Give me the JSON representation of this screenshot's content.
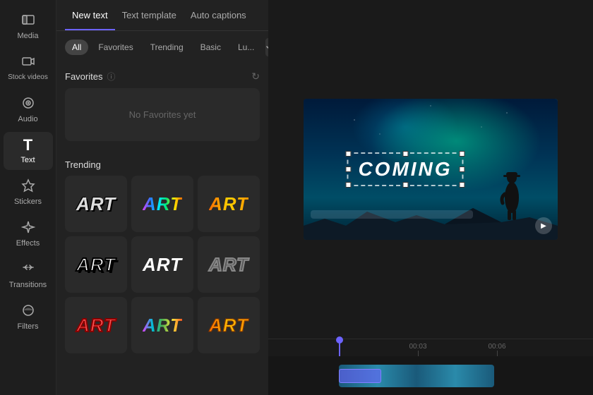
{
  "sidebar": {
    "items": [
      {
        "id": "media",
        "label": "Media",
        "icon": "▦"
      },
      {
        "id": "stock-videos",
        "label": "Stock videos",
        "icon": "⊞"
      },
      {
        "id": "audio",
        "label": "Audio",
        "icon": "◎"
      },
      {
        "id": "text",
        "label": "Text",
        "icon": "T"
      },
      {
        "id": "stickers",
        "label": "Stickers",
        "icon": "✦"
      },
      {
        "id": "effects",
        "label": "Effects",
        "icon": "✦"
      },
      {
        "id": "transitions",
        "label": "Transitions",
        "icon": "⇄"
      },
      {
        "id": "filters",
        "label": "Filters",
        "icon": "◑"
      }
    ]
  },
  "panel": {
    "tabs": [
      {
        "id": "new-text",
        "label": "New text"
      },
      {
        "id": "text-template",
        "label": "Text template"
      },
      {
        "id": "auto-captions",
        "label": "Auto captions"
      }
    ],
    "active_tab": "new-text",
    "filters": [
      {
        "id": "all",
        "label": "All"
      },
      {
        "id": "favorites",
        "label": "Favorites"
      },
      {
        "id": "trending",
        "label": "Trending"
      },
      {
        "id": "basic",
        "label": "Basic"
      },
      {
        "id": "lu",
        "label": "Lu..."
      }
    ],
    "favorites_section": {
      "title": "Favorites",
      "empty_message": "No Favorites yet"
    },
    "trending_section": {
      "title": "Trending",
      "items": [
        {
          "id": "art-1",
          "style": "plain"
        },
        {
          "id": "art-2",
          "style": "rainbow"
        },
        {
          "id": "art-3",
          "style": "gold"
        },
        {
          "id": "art-4",
          "style": "outline"
        },
        {
          "id": "art-5",
          "style": "bold-white"
        },
        {
          "id": "art-6",
          "style": "dark"
        },
        {
          "id": "art-7",
          "style": "r3-1"
        },
        {
          "id": "art-8",
          "style": "r3-2"
        },
        {
          "id": "art-9",
          "style": "r3-3"
        }
      ]
    }
  },
  "canvas": {
    "text_overlay": "COMING"
  },
  "timeline": {
    "markers": [
      {
        "time": "00:03",
        "pos": 40
      },
      {
        "time": "00:06",
        "pos": 80
      }
    ]
  }
}
